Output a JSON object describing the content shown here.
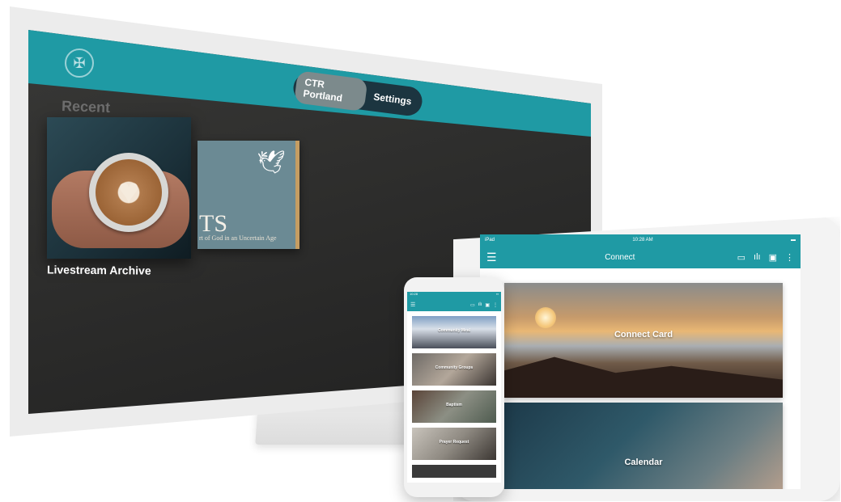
{
  "tv": {
    "tabs": [
      {
        "label": "CTR Portland",
        "active": true
      },
      {
        "label": "Settings",
        "active": false
      }
    ],
    "section_title": "Recent",
    "cards": [
      {
        "label": "Livestream Archive"
      },
      {
        "label": "",
        "book_title": "TS",
        "book_subtitle": "rt of God in an Uncertain Age"
      }
    ]
  },
  "tablet": {
    "status": {
      "left": "iPad",
      "time": "10:28 AM",
      "right": "▬"
    },
    "title": "Connect",
    "tiles": [
      "Connect Card",
      "Calendar"
    ]
  },
  "phone": {
    "status": {
      "time": "10:28",
      "right": "▪▪"
    },
    "tiles": [
      "Community Meal",
      "Community Groups",
      "Baptism",
      "Prayer Request"
    ]
  },
  "colors": {
    "accent": "#1f9aa4",
    "tv_background": "#2b2b2a"
  }
}
